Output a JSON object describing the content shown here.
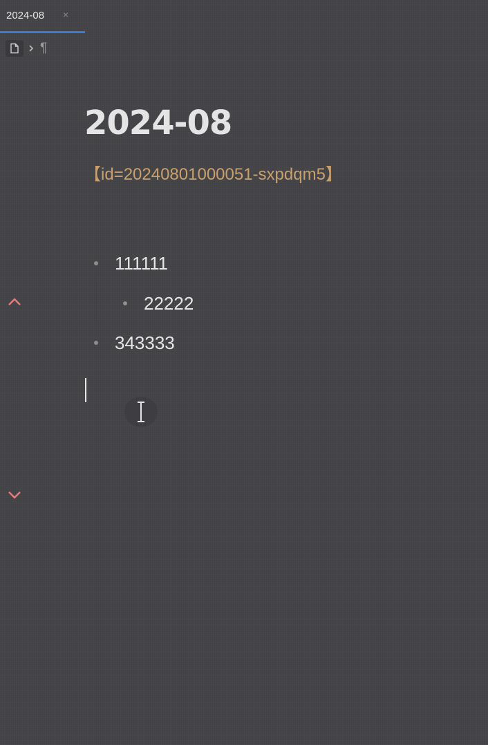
{
  "tab": {
    "title": "2024-08",
    "close_label": "×"
  },
  "breadcrumb": {
    "items": [
      "doc-icon",
      "chevron-right-icon",
      "paragraph-icon"
    ],
    "paragraph_symbol": "¶"
  },
  "document": {
    "title": "2024-08",
    "attribute": "【id=20240801000051-sxpdqm5】"
  },
  "list": {
    "items": [
      {
        "text": "111111",
        "level": 0
      },
      {
        "text": "22222",
        "level": 1
      },
      {
        "text": "343333",
        "level": 0
      }
    ]
  },
  "gutter": {
    "up_icon": "chevron-up-icon",
    "down_icon": "chevron-down-icon",
    "accent_color": "#e87c7c"
  },
  "colors": {
    "background": "#47474b",
    "tab_underline": "#3b7bd8",
    "attribute_text": "#c8a06e"
  }
}
